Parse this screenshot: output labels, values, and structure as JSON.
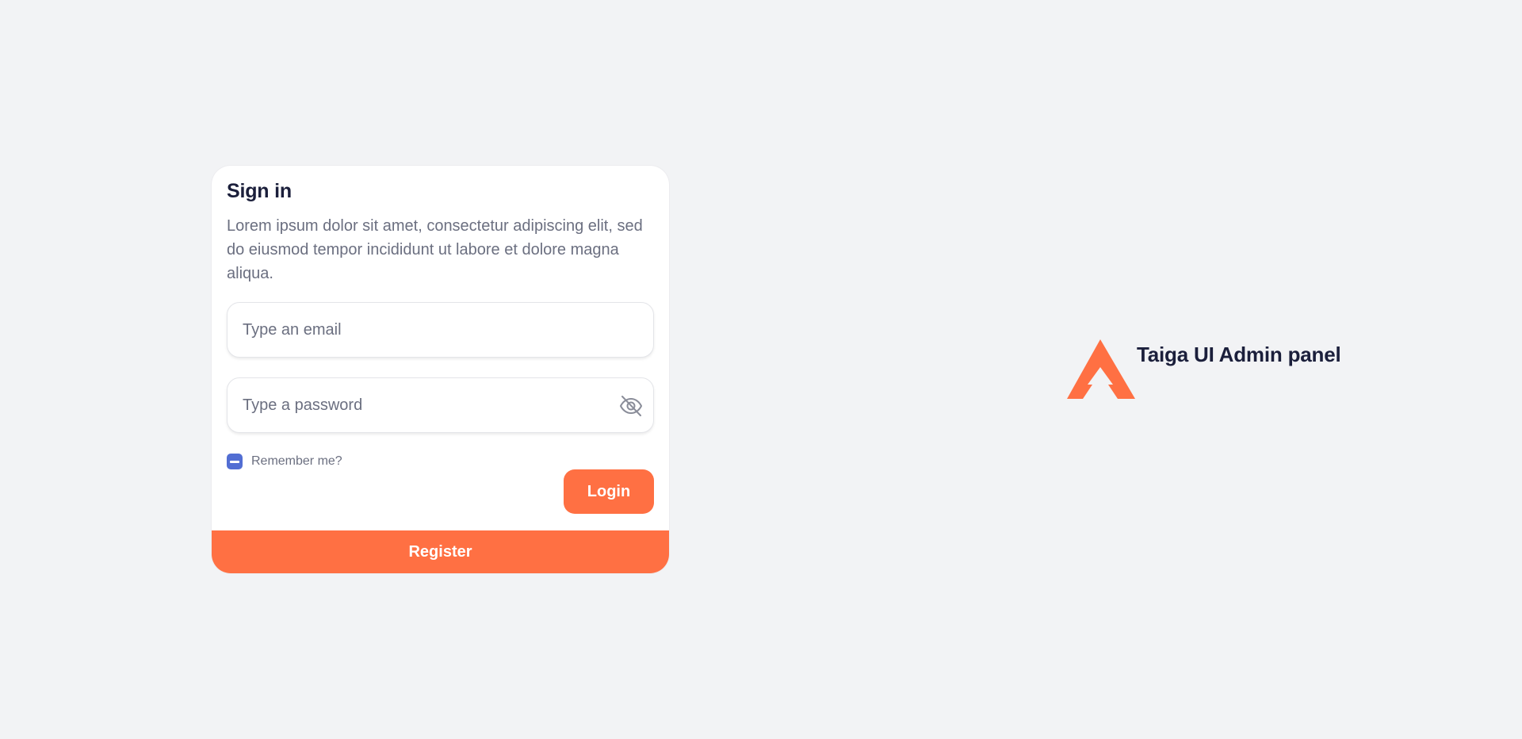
{
  "signin": {
    "title": "Sign in",
    "description": "Lorem ipsum dolor sit amet, consectetur adipiscing elit, sed do eiusmod tempor incididunt ut labore et dolore magna aliqua.",
    "email_placeholder": "Type an email",
    "password_placeholder": "Type a password",
    "remember_label": "Remember me?",
    "remember_state": "indeterminate",
    "login_label": "Login",
    "register_label": "Register"
  },
  "brand": {
    "name": "Taiga UI Admin panel",
    "logo_icon": "taiga-logo-icon",
    "accent_color": "#ff7043"
  },
  "colors": {
    "accent": "#ff7043",
    "checkbox": "#526ed3",
    "background": "#f2f3f5"
  }
}
